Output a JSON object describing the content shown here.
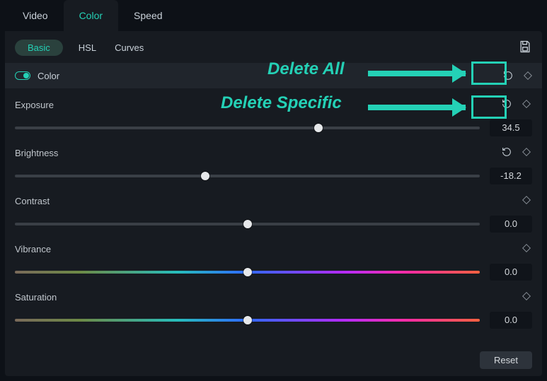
{
  "topTabs": {
    "video": "Video",
    "color": "Color",
    "speed": "Speed"
  },
  "subTabs": {
    "basic": "Basic",
    "hsl": "HSL",
    "curves": "Curves"
  },
  "section": {
    "title": "Color"
  },
  "props": {
    "exposure": {
      "label": "Exposure",
      "value": "34.5",
      "pos": 65.3,
      "rainbow": false,
      "showReset": true
    },
    "brightness": {
      "label": "Brightness",
      "value": "-18.2",
      "pos": 40.9,
      "rainbow": false,
      "showReset": true
    },
    "contrast": {
      "label": "Contrast",
      "value": "0.0",
      "pos": 50,
      "rainbow": false,
      "showReset": false
    },
    "vibrance": {
      "label": "Vibrance",
      "value": "0.0",
      "pos": 50,
      "rainbow": true,
      "showReset": false
    },
    "saturation": {
      "label": "Saturation",
      "value": "0.0",
      "pos": 50,
      "rainbow": true,
      "showReset": false
    }
  },
  "buttons": {
    "reset": "Reset"
  },
  "annotations": {
    "deleteAll": "Delete All",
    "deleteSpecific": "Delete Specific"
  }
}
